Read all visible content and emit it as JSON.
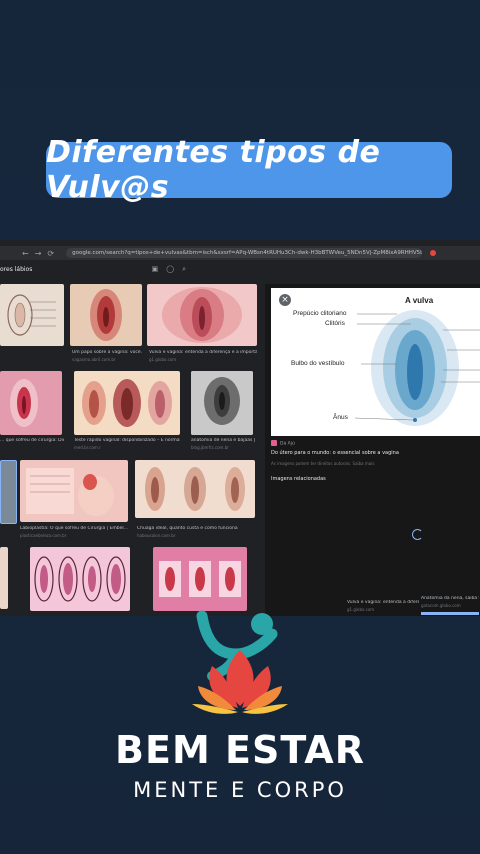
{
  "title_banner": "Diferentes tipos de Vulv@s",
  "browser": {
    "url": "google.com/search?q=tipos+de+vulvas&tbm=isch&sxsrf=APq-WBsn4tRUHu3Ch-dwk-H3bBTWVeu_5NDn5Vj-ZpM8ixA9RHHV5bxOdOLwQ"
  },
  "search": {
    "label": "ores lábios"
  },
  "results": [
    {
      "caption": "Um papo sobre a vagina: você...",
      "source": "vagasmo.abril.com.br"
    },
    {
      "caption": "Vulva e vagina: entenda a diferença e a importânci...",
      "source": "g1.globo.com"
    },
    {
      "caption": "... que sofreu de cirurgia: Dic...",
      "source": ""
    },
    {
      "caption": "Teste rápido vaginal: disponibilizado – É normal?",
      "source": "med.br.com.r"
    },
    {
      "caption": "anatomia de nena e bajaas |...",
      "source": "blog.jbmfrz.com.br"
    },
    {
      "caption": "Labioplastia: O que sofreu de Cirurgia | Embel...",
      "source": "plasticaebeleza.com.br"
    },
    {
      "caption": "Chuaga ideal, quanto custa e como funciona",
      "source": "habousalon.com.br"
    }
  ],
  "panel": {
    "diagram_title": "A vulva",
    "labels": {
      "prepucio": "Prepúcio clitoriano",
      "clitoris": "Clitóris",
      "bulbo": "Bulbo do vestíbulo",
      "anus": "Ânus"
    },
    "source": "Dá Ajú",
    "title": "Do útero para o mundo: o essencial sobre a vagina",
    "subtitle": "As imagens podem ter direitos autorais. Saiba mais",
    "related": "Imagens relacionadas",
    "bottom_left_caption": "Vulva e vagina: entenda a diferen...",
    "bottom_left_source": "g1.globo.com",
    "bottom_right_caption": "Anatomia da nena, saiba tud...",
    "bottom_right_source": "gatocom.globo.com"
  },
  "brand": {
    "line1": "BEM ESTAR",
    "line2": "MENTE E CORPO"
  },
  "colors": {
    "background": "#15253a",
    "banner": "#4d96ea",
    "logo_teal": "#2aa6a8",
    "logo_red": "#e5463f",
    "logo_orange": "#f28a3c",
    "logo_yellow": "#f6c343"
  }
}
